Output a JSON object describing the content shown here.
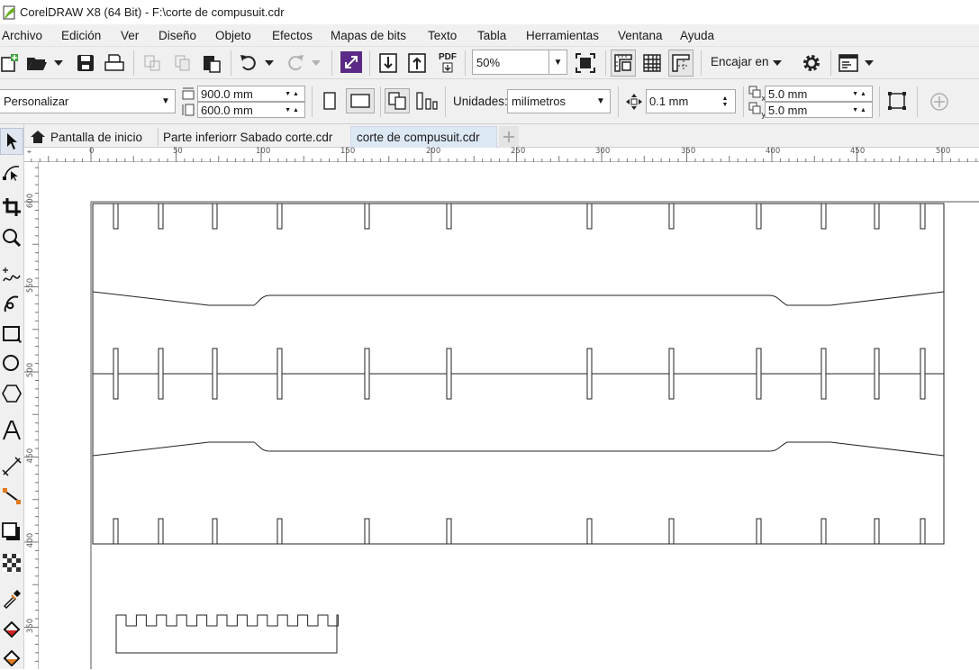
{
  "window": {
    "title": "CorelDRAW X8 (64 Bit) - F:\\corte de compusuit.cdr"
  },
  "menu": [
    "Archivo",
    "Edición",
    "Ver",
    "Diseño",
    "Objeto",
    "Efectos",
    "Mapas de bits",
    "Texto",
    "Tabla",
    "Herramientas",
    "Ventana",
    "Ayuda"
  ],
  "toolbar": {
    "zoom_value": "50%",
    "snap_label": "Encajar en",
    "pdf_label": "PDF"
  },
  "propertybar": {
    "page_preset": "Personalizar",
    "width": "900.0 mm",
    "height": "600.0 mm",
    "units_label": "Unidades:",
    "units_value": "milímetros",
    "nudge": "0.1 mm",
    "dup_x": "5.0 mm",
    "dup_y": "5.0 mm",
    "x_sub": "x",
    "y_sub": "y"
  },
  "tabs": [
    {
      "label": "Pantalla de inicio"
    },
    {
      "label": "Parte inferiorr Sabado corte.cdr"
    },
    {
      "label": "corte de compusuit.cdr"
    }
  ],
  "ruler": {
    "h_labels": [
      "0",
      "50",
      "100",
      "150",
      "200",
      "250",
      "300",
      "350",
      "400",
      "450",
      "500"
    ],
    "v_labels": [
      "600",
      "550",
      "500",
      "450",
      "400",
      "350"
    ]
  },
  "colors": {
    "chrome": "#f0f0f0",
    "active_tab": "#dde8f5",
    "accent_purple": "#5b2a86",
    "logo_green": "#6ab023"
  }
}
